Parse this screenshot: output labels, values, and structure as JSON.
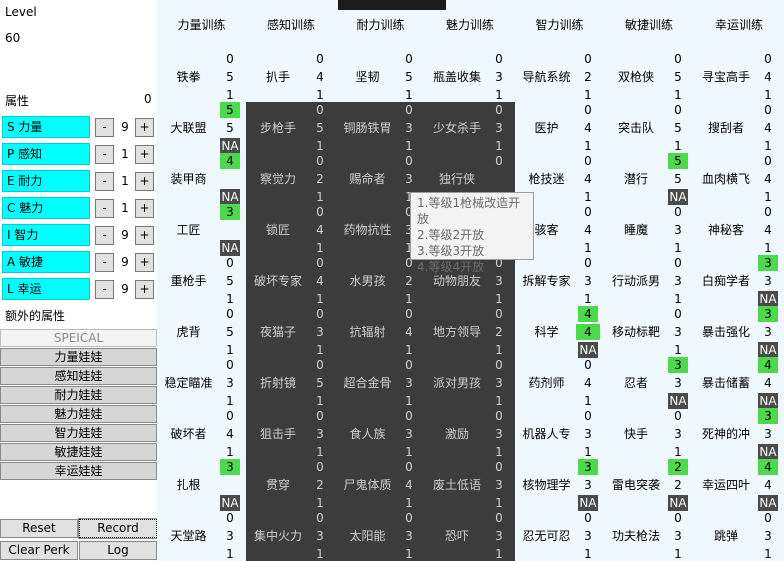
{
  "left": {
    "level_label": "Level",
    "level_value": "60",
    "attr_label": "属性",
    "attr_value": "0",
    "extra_label": "额外的属性",
    "stats": [
      {
        "label": "S 力量",
        "value": "9"
      },
      {
        "label": "P 感知",
        "value": "1"
      },
      {
        "label": "E 耐力",
        "value": "1"
      },
      {
        "label": "C 魅力",
        "value": "1"
      },
      {
        "label": "I 智力",
        "value": "9"
      },
      {
        "label": "A 敏捷",
        "value": "9"
      },
      {
        "label": "L 幸运",
        "value": "9"
      }
    ],
    "minus": "-",
    "plus": "+",
    "special_label": "SPEICAL",
    "bobbleheads": [
      "力量娃娃",
      "感知娃娃",
      "耐力娃娃",
      "魅力娃娃",
      "智力娃娃",
      "敏捷娃娃",
      "幸运娃娃"
    ],
    "buttons": {
      "reset": "Reset",
      "record": "Record",
      "clear": "Clear Perk",
      "log": "Log"
    }
  },
  "tabs": [
    "力量训练",
    "感知训练",
    "耐力训练",
    "魅力训练",
    "智力训练",
    "敏捷训练",
    "幸运训练"
  ],
  "tooltip": [
    "1.等级1枪械改造开放",
    "2.等级2开放",
    "3.等级3开放",
    "4.等级4开放"
  ],
  "columns": [
    {
      "dark": false,
      "perks": [
        {
          "name": "铁拳",
          "top": "0",
          "cur": "5",
          "bot": "1",
          "cs": ""
        },
        {
          "name": "大联盟",
          "top": "5",
          "cur": "5",
          "bot": "NA",
          "ts": "g",
          "bs": "n"
        },
        {
          "name": "装甲商",
          "top": "4",
          "cur": "",
          "bot": "NA",
          "ts": "g",
          "bs": "n"
        },
        {
          "name": "工匠",
          "top": "3",
          "cur": "",
          "bot": "NA",
          "ts": "g",
          "bs": "n"
        },
        {
          "name": "重枪手",
          "top": "0",
          "cur": "5",
          "bot": "1"
        },
        {
          "name": "虎背",
          "top": "0",
          "cur": "5",
          "bot": "1"
        },
        {
          "name": "稳定瞄准",
          "top": "0",
          "cur": "3",
          "bot": "1"
        },
        {
          "name": "破坏者",
          "top": "0",
          "cur": "4",
          "bot": "1"
        },
        {
          "name": "扎根",
          "top": "3",
          "cur": "",
          "bot": "NA",
          "ts": "g",
          "bs": "n"
        },
        {
          "name": "天堂路",
          "top": "0",
          "cur": "3",
          "bot": "1"
        }
      ]
    },
    {
      "dark": true,
      "perks": [
        {
          "name": "扒手",
          "top": "0",
          "cur": "4",
          "bot": "1"
        },
        {
          "name": "步枪手",
          "top": "0",
          "cur": "5",
          "bot": "1"
        },
        {
          "name": "察觉力",
          "top": "0",
          "cur": "2",
          "bot": "1"
        },
        {
          "name": "锁匠",
          "top": "0",
          "cur": "4",
          "bot": "1"
        },
        {
          "name": "破坏专家",
          "top": "0",
          "cur": "4",
          "bot": "1"
        },
        {
          "name": "夜猫子",
          "top": "0",
          "cur": "3",
          "bot": "1"
        },
        {
          "name": "折射镜",
          "top": "0",
          "cur": "5",
          "bot": "1"
        },
        {
          "name": "狙击手",
          "top": "0",
          "cur": "3",
          "bot": "1"
        },
        {
          "name": "贯穿",
          "top": "0",
          "cur": "2",
          "bot": "1"
        },
        {
          "name": "集中火力",
          "top": "0",
          "cur": "3",
          "bot": "1"
        }
      ]
    },
    {
      "dark": true,
      "perks": [
        {
          "name": "坚韧",
          "top": "0",
          "cur": "5",
          "bot": "1"
        },
        {
          "name": "铜肠铁胃",
          "top": "0",
          "cur": "3",
          "bot": "1"
        },
        {
          "name": "赐命者",
          "top": "0",
          "cur": "3",
          "bot": "1"
        },
        {
          "name": "药物抗性",
          "top": "0",
          "cur": "3",
          "bot": "1"
        },
        {
          "name": "水男孩",
          "top": "0",
          "cur": "2",
          "bot": "1"
        },
        {
          "name": "抗辐射",
          "top": "0",
          "cur": "4",
          "bot": "1"
        },
        {
          "name": "超合金骨",
          "top": "0",
          "cur": "3",
          "bot": "1"
        },
        {
          "name": "食人族",
          "top": "0",
          "cur": "3",
          "bot": "1"
        },
        {
          "name": "尸鬼体质",
          "top": "0",
          "cur": "4",
          "bot": "1"
        },
        {
          "name": "太阳能",
          "top": "0",
          "cur": "3",
          "bot": "1"
        }
      ]
    },
    {
      "dark": true,
      "perks": [
        {
          "name": "瓶盖收集",
          "top": "0",
          "cur": "3",
          "bot": "1"
        },
        {
          "name": "少女杀手",
          "top": "0",
          "cur": "3",
          "bot": "1"
        },
        {
          "name": "独行侠",
          "top": "0",
          "cur": "",
          "bot": "1"
        },
        {
          "name": "",
          "top": "",
          "cur": "",
          "bot": ""
        },
        {
          "name": "动物朋友",
          "top": "0",
          "cur": "3",
          "bot": "1"
        },
        {
          "name": "地方领导",
          "top": "0",
          "cur": "2",
          "bot": "1"
        },
        {
          "name": "派对男孩",
          "top": "0",
          "cur": "3",
          "bot": "1"
        },
        {
          "name": "激励",
          "top": "0",
          "cur": "3",
          "bot": "1"
        },
        {
          "name": "废土低语",
          "top": "0",
          "cur": "3",
          "bot": "1"
        },
        {
          "name": "恐吓",
          "top": "0",
          "cur": "3",
          "bot": "1"
        }
      ]
    },
    {
      "dark": false,
      "perks": [
        {
          "name": "导航系统",
          "top": "0",
          "cur": "2",
          "bot": "1"
        },
        {
          "name": "医护",
          "top": "0",
          "cur": "4",
          "bot": "1"
        },
        {
          "name": "枪技迷",
          "top": "0",
          "cur": "4",
          "bot": "1"
        },
        {
          "name": "骇客",
          "top": "0",
          "cur": "4",
          "bot": "1"
        },
        {
          "name": "拆解专家",
          "top": "0",
          "cur": "3",
          "bot": "1"
        },
        {
          "name": "科学",
          "top": "4",
          "cur": "4",
          "bot": "NA",
          "ts": "g",
          "cs": "g",
          "bs": "n"
        },
        {
          "name": "药剂师",
          "top": "0",
          "cur": "4",
          "bot": "1"
        },
        {
          "name": "机器人专",
          "top": "0",
          "cur": "3",
          "bot": "1"
        },
        {
          "name": "核物理学",
          "top": "3",
          "cur": "3",
          "bot": "NA",
          "ts": "g",
          "bs": "n"
        },
        {
          "name": "忍无可忍",
          "top": "0",
          "cur": "3",
          "bot": "1"
        }
      ]
    },
    {
      "dark": false,
      "perks": [
        {
          "name": "双枪侠",
          "top": "0",
          "cur": "5",
          "bot": "1"
        },
        {
          "name": "突击队",
          "top": "0",
          "cur": "5",
          "bot": "1"
        },
        {
          "name": "潜行",
          "top": "5",
          "cur": "5",
          "bot": "NA",
          "ts": "g",
          "bs": "n"
        },
        {
          "name": "睡魔",
          "top": "0",
          "cur": "3",
          "bot": "1"
        },
        {
          "name": "行动派男",
          "top": "0",
          "cur": "3",
          "bot": "1"
        },
        {
          "name": "移动标靶",
          "top": "0",
          "cur": "3",
          "bot": "1"
        },
        {
          "name": "忍者",
          "top": "3",
          "cur": "3",
          "bot": "NA",
          "ts": "g",
          "bs": "n"
        },
        {
          "name": "快手",
          "top": "0",
          "cur": "3",
          "bot": "1"
        },
        {
          "name": "雷电突袭",
          "top": "2",
          "cur": "2",
          "bot": "NA",
          "ts": "g",
          "bs": "n"
        },
        {
          "name": "功夫枪法",
          "top": "0",
          "cur": "3",
          "bot": "1"
        }
      ]
    },
    {
      "dark": false,
      "perks": [
        {
          "name": "寻宝高手",
          "top": "0",
          "cur": "4",
          "bot": "1"
        },
        {
          "name": "搜刮者",
          "top": "0",
          "cur": "4",
          "bot": "1"
        },
        {
          "name": "血肉横飞",
          "top": "0",
          "cur": "4",
          "bot": "1"
        },
        {
          "name": "神秘客",
          "top": "0",
          "cur": "4",
          "bot": "1"
        },
        {
          "name": "白痴学者",
          "top": "3",
          "cur": "3",
          "bot": "NA",
          "ts": "g",
          "bs": "n"
        },
        {
          "name": "暴击强化",
          "top": "3",
          "cur": "3",
          "bot": "NA",
          "ts": "g",
          "bs": "n"
        },
        {
          "name": "暴击储蓄",
          "top": "4",
          "cur": "4",
          "bot": "NA",
          "ts": "g",
          "bs": "n"
        },
        {
          "name": "死神的冲",
          "top": "3",
          "cur": "3",
          "bot": "NA",
          "ts": "g",
          "bs": "n"
        },
        {
          "name": "幸运四叶",
          "top": "4",
          "cur": "4",
          "bot": "NA",
          "ts": "g",
          "bs": "n"
        },
        {
          "name": "跳弹",
          "top": "0",
          "cur": "3",
          "bot": "1"
        }
      ]
    }
  ]
}
